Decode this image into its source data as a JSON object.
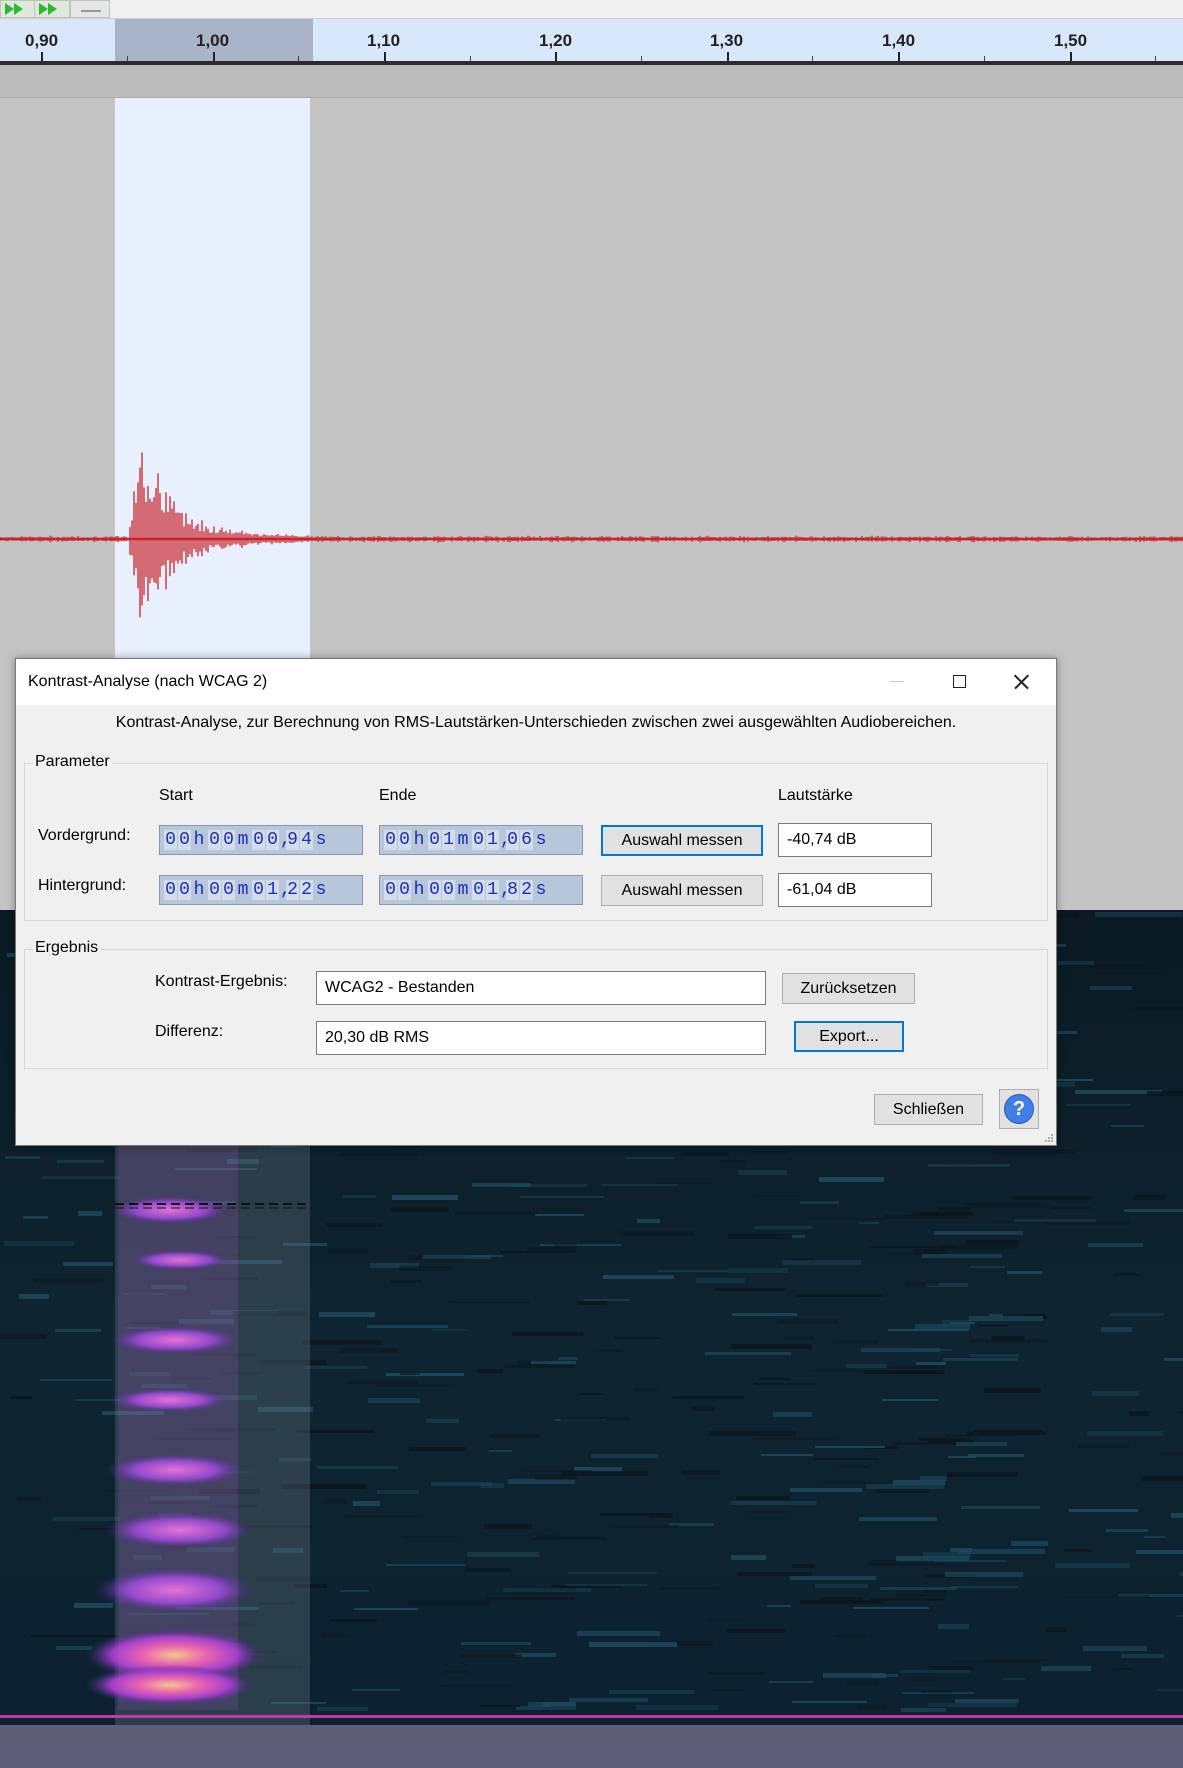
{
  "ruler": {
    "labels": [
      "0,90",
      "1,00",
      "1,10",
      "1,20",
      "1,30",
      "1,40",
      "1,50"
    ]
  },
  "dialog": {
    "title": "Kontrast-Analyse (nach WCAG 2)",
    "description": "Kontrast-Analyse, zur Berechnung von RMS-Lautstärken-Unterschieden zwischen zwei ausgewählten Audiobereichen.",
    "parameter": {
      "group_label": "Parameter",
      "col_start": "Start",
      "col_end": "Ende",
      "col_volume": "Lautstärke",
      "rows": [
        {
          "label": "Vordergrund:",
          "start": {
            "h": "00",
            "m": "00",
            "s": "00,94"
          },
          "end": {
            "h": "00",
            "m": "01",
            "s": "01,06"
          },
          "button": "Auswahl messen",
          "volume": "-40,74 dB"
        },
        {
          "label": "Hintergrund:",
          "start": {
            "h": "00",
            "m": "00",
            "s": "01,22"
          },
          "end": {
            "h": "00",
            "m": "00",
            "s": "01,82"
          },
          "button": "Auswahl messen",
          "volume": "-61,04 dB"
        }
      ]
    },
    "result": {
      "group_label": "Ergebnis",
      "contrast_label": "Kontrast-Ergebnis:",
      "contrast_value": "WCAG2 - Bestanden",
      "reset_button": "Zurücksetzen",
      "diff_label": "Differenz:",
      "diff_value": "20,30 dB RMS",
      "export_button": "Export..."
    },
    "close_button": "Schließen",
    "help_symbol": "?"
  },
  "units": {
    "h": "h",
    "m": "m",
    "s": "s"
  },
  "colors": {
    "waveform": "#c8242a",
    "selection": "#e9f0fd",
    "focus": "#0078d7",
    "timecode_digits": "#1a2fb8"
  }
}
